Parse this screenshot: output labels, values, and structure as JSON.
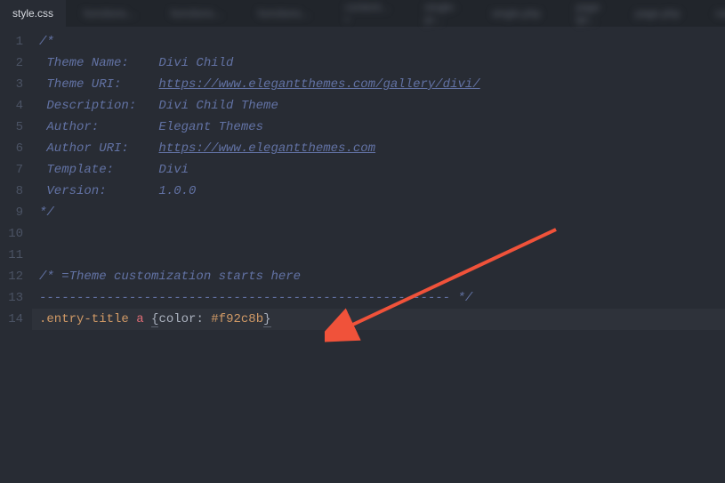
{
  "tabs": {
    "active": "style.css"
  },
  "lines": {
    "l1": "1",
    "l2": "2",
    "l3": "3",
    "l4": "4",
    "l5": "5",
    "l6": "6",
    "l7": "7",
    "l8": "8",
    "l9": "9",
    "l10": "10",
    "l11": "11",
    "l12": "12",
    "l13": "13",
    "l14": "14"
  },
  "code": {
    "c1": "/*",
    "c2_label": " Theme Name:    ",
    "c2_value": "Divi Child",
    "c3_label": " Theme URI:     ",
    "c3_value": "https://www.elegantthemes.com/gallery/divi/",
    "c4_label": " Description:   ",
    "c4_value": "Divi Child Theme",
    "c5_label": " Author:        ",
    "c5_value": "Elegant Themes",
    "c6_label": " Author URI:    ",
    "c6_value": "https://www.elegantthemes.com",
    "c7_label": " Template:      ",
    "c7_value": "Divi",
    "c8_label": " Version:       ",
    "c8_value": "1.0.0",
    "c9": "*/",
    "c12": "/* =Theme customization starts here",
    "c13": "------------------------------------------------------- */",
    "c14_sel_class": ".entry-title",
    "c14_sel_tag": " a ",
    "c14_brace_open": "{",
    "c14_prop": "color",
    "c14_colon": ": ",
    "c14_val": "#f92c8b",
    "c14_brace_close": "}"
  }
}
